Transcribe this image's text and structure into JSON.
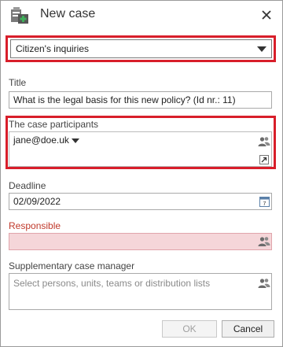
{
  "dialog": {
    "title": "New case",
    "icons": {
      "app": "case-app-icon",
      "close": "close-icon"
    }
  },
  "case_type": {
    "selected": "Citizen's inquiries"
  },
  "title_field": {
    "label": "Title",
    "value": "What is the legal basis for this new policy? (Id nr.: 11)"
  },
  "participants": {
    "label": "The case participants",
    "value": "jane@doe.uk"
  },
  "deadline": {
    "label": "Deadline",
    "value": "02/09/2022"
  },
  "responsible": {
    "label": "Responsible",
    "value": ""
  },
  "supplementary": {
    "label": "Supplementary case manager",
    "placeholder": "Select persons, units, teams or distribution lists"
  },
  "buttons": {
    "ok": "OK",
    "cancel": "Cancel"
  },
  "colors": {
    "highlight": "#d81e2a",
    "required_bg": "#f5d6d9",
    "required_border": "#e0a5ab",
    "required_label": "#c0392b"
  }
}
